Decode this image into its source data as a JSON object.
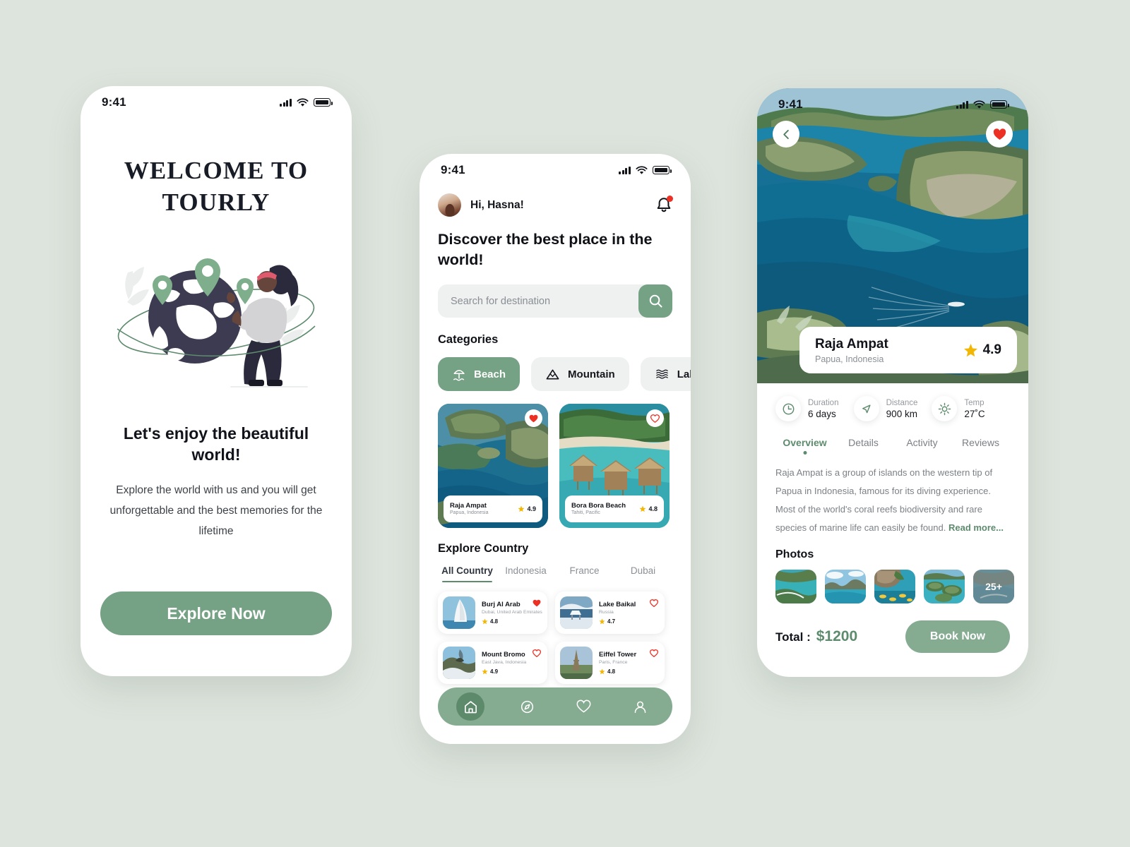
{
  "theme": {
    "background": "#dde4dd",
    "accent": "#75a184",
    "accent_light": "#85ab91",
    "dark": "#11131a",
    "star": "#f2b705",
    "heart": "#ed3024"
  },
  "status_bar": {
    "time": "9:41"
  },
  "screen1": {
    "title": "WELCOME TO TOURLY",
    "heading": "Let's enjoy the beautiful world!",
    "body": "Explore the world with us and you will get unforgettable and the best memories for the lifetime",
    "cta_label": "Explore Now"
  },
  "screen2": {
    "greeting": "Hi, Hasna!",
    "title": "Discover the best place in the world!",
    "search": {
      "placeholder": "Search for destination",
      "value": ""
    },
    "categories_title": "Categories",
    "categories": [
      {
        "label": "Beach",
        "icon": "beach-umbrella-icon",
        "active": true
      },
      {
        "label": "Mountain",
        "icon": "mountain-icon",
        "active": false
      },
      {
        "label": "Lake",
        "icon": "waves-icon",
        "active": false
      }
    ],
    "destinations": [
      {
        "name": "Raja Ampat",
        "location": "Papua, Indonesia",
        "rating": "4.9",
        "favorite": true
      },
      {
        "name": "Bora Bora Beach",
        "location": "Tahiti, Pacific",
        "rating": "4.8",
        "favorite": false
      }
    ],
    "explore_title": "Explore Country",
    "country_tabs": [
      {
        "label": "All Country",
        "active": true
      },
      {
        "label": "Indonesia",
        "active": false
      },
      {
        "label": "France",
        "active": false
      },
      {
        "label": "Dubai",
        "active": false
      }
    ],
    "places": [
      {
        "name": "Burj Al Arab",
        "location": "Dubai, United Arab Emirates",
        "rating": "4.8",
        "favorite": true
      },
      {
        "name": "Lake Baikal",
        "location": "Russia",
        "rating": "4.7",
        "favorite": false
      },
      {
        "name": "Mount Bromo",
        "location": "East Java, Indonesia",
        "rating": "4.9",
        "favorite": false
      },
      {
        "name": "Eiffel Tower",
        "location": "Paris, France",
        "rating": "4.8",
        "favorite": false
      }
    ],
    "nav": [
      {
        "icon": "home-icon",
        "active": true
      },
      {
        "icon": "compass-icon",
        "active": false
      },
      {
        "icon": "heart-icon",
        "active": false
      },
      {
        "icon": "person-icon",
        "active": false
      }
    ]
  },
  "screen3": {
    "place": {
      "name": "Raja Ampat",
      "location": "Papua, Indonesia",
      "rating": "4.9"
    },
    "favorite": true,
    "stats": [
      {
        "icon": "clock-icon",
        "label": "Duration",
        "value": "6 days"
      },
      {
        "icon": "navigation-icon",
        "label": "Distance",
        "value": "900 km"
      },
      {
        "icon": "sun-icon",
        "label": "Temp",
        "value": "27˚C"
      }
    ],
    "tabs": [
      {
        "label": "Overview",
        "active": true
      },
      {
        "label": "Details",
        "active": false
      },
      {
        "label": "Activity",
        "active": false
      },
      {
        "label": "Reviews",
        "active": false
      }
    ],
    "description": "Raja Ampat is a group of islands on the western tip of Papua in Indonesia, famous for its diving experience. Most of the world's coral reefs biodiversity and rare species of marine life can easily be found. ",
    "read_more": "Read more...",
    "photos_title": "Photos",
    "photos_more_badge": "25+",
    "total_label": "Total :",
    "total_value": "$1200",
    "book_label": "Book Now"
  }
}
